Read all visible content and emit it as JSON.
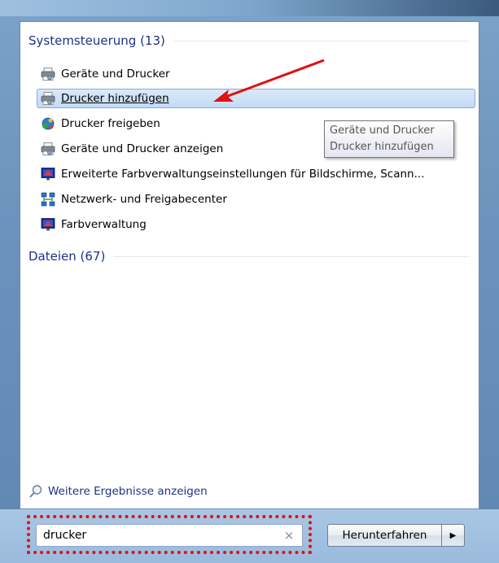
{
  "groups": [
    {
      "header": "Systemsteuerung (13)",
      "items": [
        {
          "label": "Geräte und Drucker",
          "icon": "printer-icon"
        },
        {
          "label": "Drucker hinzufügen",
          "icon": "printer-icon",
          "selected": true
        },
        {
          "label": "Drucker freigeben",
          "icon": "network-share-icon"
        },
        {
          "label": "Geräte und Drucker anzeigen",
          "icon": "printer-icon"
        },
        {
          "label": "Erweiterte Farbverwaltungseinstellungen für Bildschirme, Scann...",
          "icon": "monitor-color-icon"
        },
        {
          "label": "Netzwerk- und Freigabecenter",
          "icon": "network-icon"
        },
        {
          "label": "Farbverwaltung",
          "icon": "monitor-color-icon"
        }
      ]
    },
    {
      "header": "Dateien (67)",
      "items": []
    }
  ],
  "tooltip": {
    "line1": "Geräte und Drucker",
    "line2": "Drucker hinzufügen"
  },
  "more_results": "Weitere Ergebnisse anzeigen",
  "search": {
    "value": "drucker",
    "clear_symbol": "×"
  },
  "shutdown": {
    "label": "Herunterfahren",
    "arrow": "▶"
  },
  "colors": {
    "header_text": "#1e3287",
    "selection_border": "#84acdd",
    "annotation_red": "#e01010"
  }
}
